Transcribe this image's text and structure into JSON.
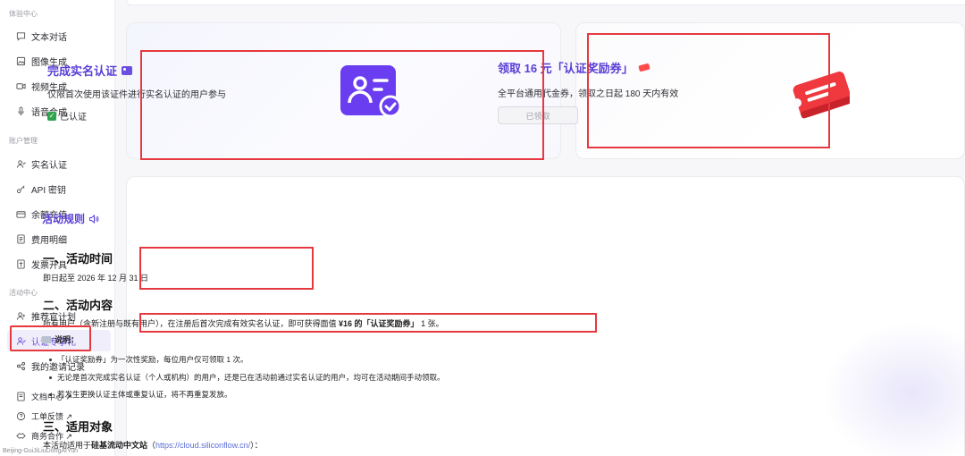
{
  "sidebar": {
    "sections": [
      {
        "label": "体验中心",
        "items": [
          {
            "label": "文本对话",
            "icon": "chat-icon"
          },
          {
            "label": "图像生成",
            "icon": "image-icon"
          },
          {
            "label": "视频生成",
            "icon": "video-icon"
          },
          {
            "label": "语音合成",
            "icon": "mic-icon"
          }
        ]
      },
      {
        "label": "账户管理",
        "items": [
          {
            "label": "实名认证",
            "icon": "user-check-icon"
          },
          {
            "label": "API 密钥",
            "icon": "key-icon"
          },
          {
            "label": "余额充值",
            "icon": "wallet-icon"
          },
          {
            "label": "费用明细",
            "icon": "list-icon"
          },
          {
            "label": "发票开具",
            "icon": "invoice-icon"
          }
        ]
      },
      {
        "label": "活动中心",
        "items": [
          {
            "label": "推荐官计划",
            "icon": "user-plus-icon"
          },
          {
            "label": "认证专享礼",
            "icon": "gift-user-icon",
            "active": true
          },
          {
            "label": "我的邀请记录",
            "icon": "share-icon"
          }
        ]
      }
    ],
    "links": [
      {
        "label": "文档中心 ↗",
        "icon": "doc-icon"
      },
      {
        "label": "工单反馈 ↗",
        "icon": "help-icon"
      },
      {
        "label": "商务合作 ↗",
        "icon": "handshake-icon"
      }
    ],
    "footer": "Beijing-GuiJiLiuDongAIYun"
  },
  "verify_card": {
    "title": "完成实名认证",
    "desc": "仅限首次使用该证件进行实名认证的用户参与",
    "status": "已认证"
  },
  "voucher_card": {
    "title": "领取 16 元「认证奖励券」",
    "desc": "全平台通用代金券，领取之日起 180 天内有效",
    "button": "已领取"
  },
  "rules": {
    "title": "活动规则",
    "time_heading": "一、活动时间",
    "time_text": "即日起至 2026 年 12 月 31 日",
    "content_heading": "二、活动内容",
    "content_prefix": "所有用户（含新注册与既有用户），在注册后首次完成有效实名认证，即可获得面值",
    "content_bold": "¥16 的「认证奖励券」",
    "content_suffix": "1 张。",
    "note_label": "说明：",
    "notes": [
      "「认证奖励券」为一次性奖励，每位用户仅可领取 1 次。",
      "无论是首次完成实名认证（个人或机构）的用户，还是已在活动前通过实名认证的用户，均可在活动期间手动领取。",
      "若发生更换认证主体或重复认证，将不再重复发放。"
    ],
    "target_heading": "三、适用对象",
    "target_prefix": "本活动适用于",
    "target_bold": "硅基流动中文站",
    "target_link": "https://cloud.siliconflow.cn/",
    "target_open": "（",
    "target_close": "）："
  },
  "colors": {
    "accent": "#5a3ed6",
    "highlight": "#e6393f"
  }
}
